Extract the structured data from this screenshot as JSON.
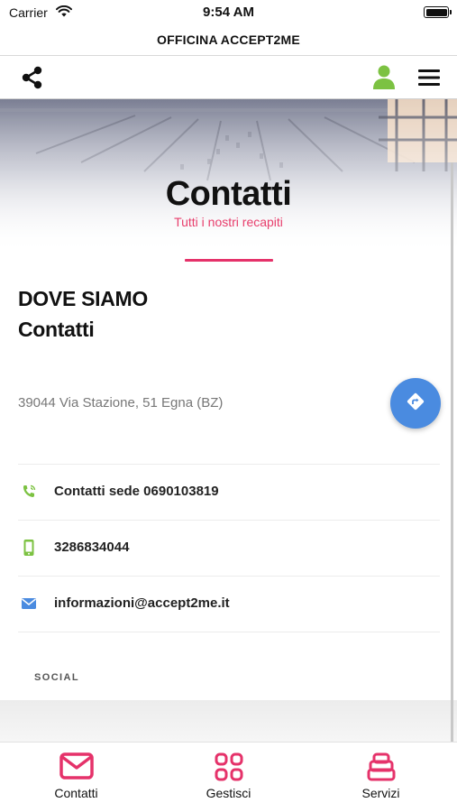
{
  "status_bar": {
    "carrier": "Carrier",
    "time": "9:54 AM"
  },
  "app": {
    "title": "OFFICINA ACCEPT2ME"
  },
  "toolbar": {
    "share_icon": "share-icon",
    "user_icon": "user-icon",
    "menu_icon": "hamburger-menu-icon"
  },
  "hero": {
    "title": "Contatti",
    "subtitle": "Tutti i nostri recapiti"
  },
  "location": {
    "heading_1": "DOVE SIAMO",
    "heading_2": "Contatti",
    "address": "39044 Via Stazione, 51 Egna (BZ)",
    "directions_icon": "directions-icon"
  },
  "contacts": [
    {
      "icon": "phone-icon",
      "text": "Contatti sede 0690103819"
    },
    {
      "icon": "mobile-phone-icon",
      "text": "3286834044"
    },
    {
      "icon": "envelope-icon",
      "text": "informazioni@accept2me.it"
    }
  ],
  "social": {
    "label": "SOCIAL"
  },
  "tabs": [
    {
      "label": "Contatti",
      "icon": "envelope-icon"
    },
    {
      "label": "Gestisci",
      "icon": "grid-icon"
    },
    {
      "label": "Servizi",
      "icon": "stack-icon"
    }
  ],
  "colors": {
    "accent": "#e5326a",
    "subtitle": "#e83e6c",
    "green": "#7cc242",
    "blue": "#4a8be0"
  }
}
